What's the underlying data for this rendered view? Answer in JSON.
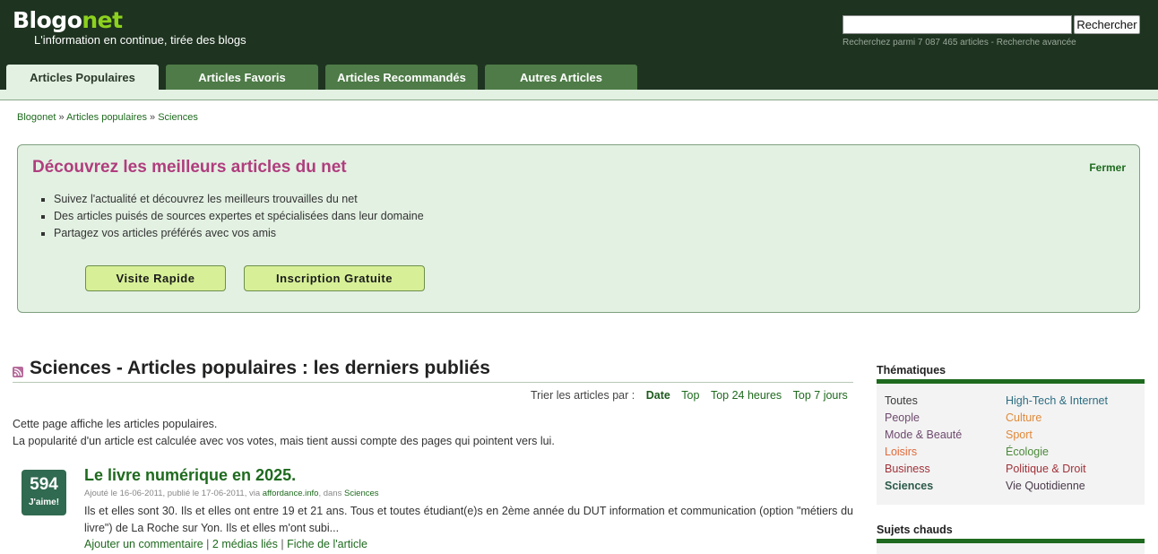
{
  "header": {
    "logo_main": "Blogo",
    "logo_accent": "net",
    "tagline": "L'information en continue, tirée des blogs",
    "search_button": "Rechercher",
    "search_hint": "Recherchez parmi 7 087 465 articles - Recherche avancée",
    "colors": {
      "header_bg": "#1e3320",
      "logo_accent": "#8cd21e",
      "tab_bg": "#4e7b47",
      "tab_active_bg": "#e3f1e3"
    }
  },
  "tabs": [
    {
      "label": "Articles Populaires",
      "active": true
    },
    {
      "label": "Articles Favoris",
      "active": false
    },
    {
      "label": "Articles Recommandés",
      "active": false
    },
    {
      "label": "Autres Articles",
      "active": false
    }
  ],
  "breadcrumb": {
    "items": [
      "Blogonet",
      "Articles populaires",
      "Sciences"
    ],
    "separator": "»"
  },
  "promo": {
    "title": "Découvrez les meilleurs articles du net",
    "close_label": "Fermer",
    "bullets": [
      "Suivez l'actualité et découvrez les meilleurs trouvailles du net",
      "Des articles puisés de sources expertes et spécialisées dans leur domaine",
      "Partagez vos articles préférés avec vos amis"
    ],
    "button_visit": "Visite Rapide",
    "button_signup": "Inscription Gratuite",
    "title_color": "#b03d7e"
  },
  "main": {
    "title": "Sciences - Articles populaires : les derniers publiés",
    "sort_label": "Trier les articles par :",
    "sort_options": [
      {
        "label": "Date",
        "selected": true
      },
      {
        "label": "Top",
        "selected": false
      },
      {
        "label": "Top 24 heures",
        "selected": false
      },
      {
        "label": "Top 7 jours",
        "selected": false
      }
    ],
    "intro_line1": "Cette page affiche les articles populaires.",
    "intro_line2": "La popularité d'un article est calculée avec vos votes, mais tient aussi compte des pages qui pointent vers lui."
  },
  "article": {
    "votes": "594",
    "vote_label": "J'aime!",
    "title": "Le livre numérique en 2025.",
    "meta_prefix": "Ajouté le 16-06-2011, publié le 17-06-2011, via ",
    "meta_source": "affordance.info",
    "meta_mid": ", dans ",
    "meta_category": "Sciences",
    "excerpt": "Ils et elles sont 30. Ils et elles ont entre 19 et 21 ans. Tous et toutes étudiant(e)s en 2ème année du DUT information et communication (option \"métiers du livre\") de La Roche sur Yon. Ils et elles m'ont subi...",
    "link_comment": "Ajouter un commentaire",
    "link_media": "2 médias liés",
    "link_sheet": "Fiche de l'article",
    "link_separator": " | "
  },
  "sidebar": {
    "themes_title": "Thématiques",
    "themes": [
      {
        "label": "Toutes",
        "color": "#3a3a3a"
      },
      {
        "label": "High-Tech & Internet",
        "color": "#2c6d82"
      },
      {
        "label": "People",
        "color": "#6e4a6e"
      },
      {
        "label": "Culture",
        "color": "#e08a3a"
      },
      {
        "label": "Mode & Beauté",
        "color": "#6e4a6e"
      },
      {
        "label": "Sport",
        "color": "#e08a3a"
      },
      {
        "label": "Loisirs",
        "color": "#e06a3a"
      },
      {
        "label": "Écologie",
        "color": "#4b8a3a"
      },
      {
        "label": "Business",
        "color": "#a0323a"
      },
      {
        "label": "Politique & Droit",
        "color": "#a0323a"
      },
      {
        "label": "Sciences",
        "color": "#2c5a4a"
      },
      {
        "label": "Vie Quotidienne",
        "color": "#4a3a4a"
      }
    ],
    "hot_title": "Sujets chauds"
  }
}
